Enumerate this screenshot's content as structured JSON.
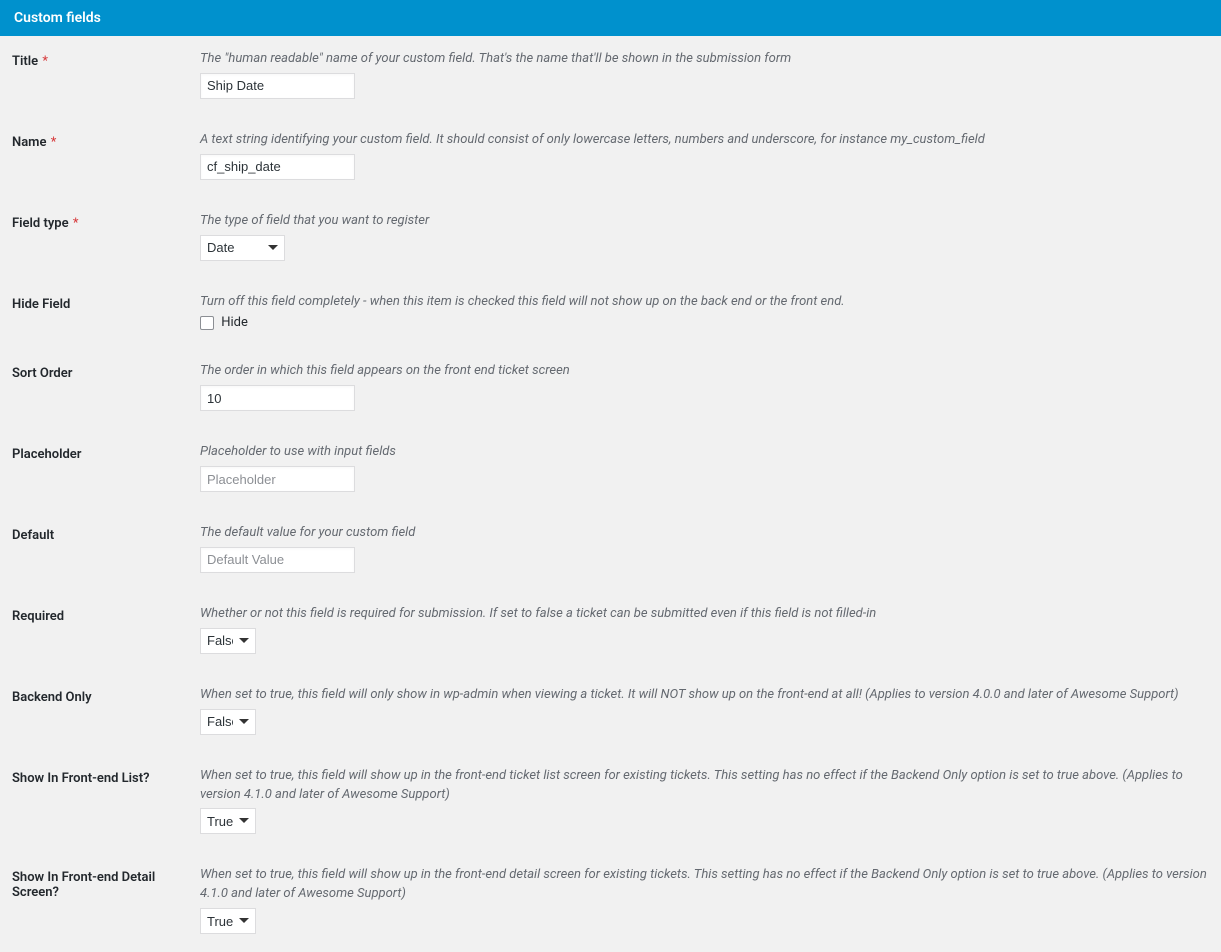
{
  "header": {
    "title": "Custom fields"
  },
  "fields": {
    "title": {
      "label": "Title",
      "required": true,
      "description": "The \"human readable\" name of your custom field. That's the name that'll be shown in the submission form",
      "value": "Ship Date"
    },
    "name": {
      "label": "Name",
      "required": true,
      "description": "A text string identifying your custom field. It should consist of only lowercase letters, numbers and underscore, for instance my_custom_field",
      "value": "cf_ship_date"
    },
    "field_type": {
      "label": "Field type",
      "required": true,
      "description": "The type of field that you want to register",
      "value": "Date"
    },
    "hide_field": {
      "label": "Hide Field",
      "description": "Turn off this field completely - when this item is checked this field will not show up on the back end or the front end.",
      "checkbox_label": "Hide"
    },
    "sort_order": {
      "label": "Sort Order",
      "description": "The order in which this field appears on the front end ticket screen",
      "value": "10"
    },
    "placeholder": {
      "label": "Placeholder",
      "description": "Placeholder to use with input fields",
      "input_placeholder": "Placeholder"
    },
    "default": {
      "label": "Default",
      "description": "The default value for your custom field",
      "input_placeholder": "Default Value"
    },
    "required_field": {
      "label": "Required",
      "description": "Whether or not this field is required for submission. If set to false a ticket can be submitted even if this field is not filled-in",
      "value": "False"
    },
    "backend_only": {
      "label": "Backend Only",
      "description": "When set to true, this field will only show in wp-admin when viewing a ticket. It will NOT show up on the front-end at all! (Applies to version 4.0.0 and later of Awesome Support)",
      "value": "False"
    },
    "show_frontend_list": {
      "label": "Show In Front-end List?",
      "description": "When set to true, this field will show up in the front-end ticket list screen for existing tickets. This setting has no effect if the Backend Only option is set to true above. (Applies to version 4.1.0 and later of Awesome Support)",
      "value": "True"
    },
    "show_frontend_detail": {
      "label": "Show In Front-end Detail Screen?",
      "description": "When set to true, this field will show up in the front-end detail screen for existing tickets. This setting has no effect if the Backend Only option is set to true above. (Applies to version 4.1.0 and later of Awesome Support)",
      "value": "True"
    }
  }
}
